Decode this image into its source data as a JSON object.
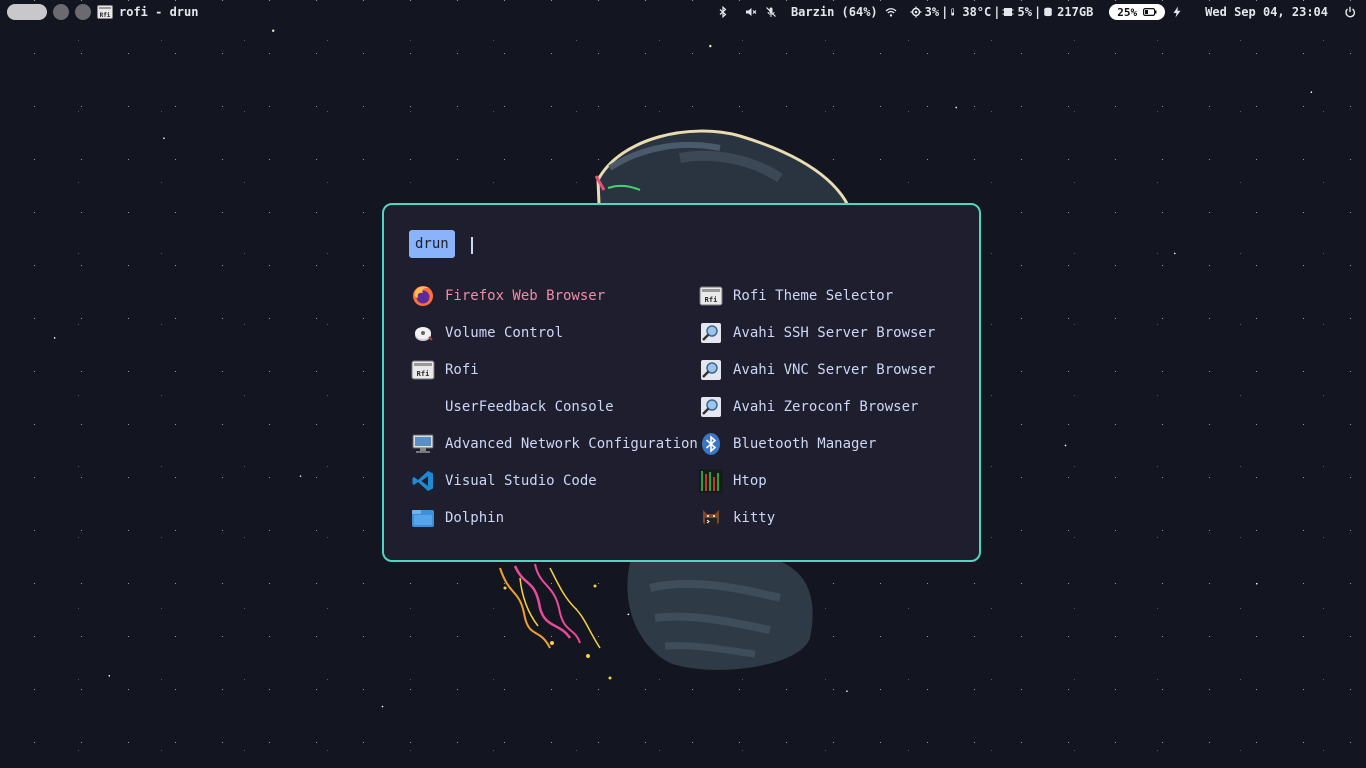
{
  "topbar": {
    "window_title": "rofi - drun",
    "wifi_label": "Barzin (64%)",
    "cpu": "3%",
    "temperature": "38°C",
    "memory": "5%",
    "disk": "217GB",
    "battery": "25%",
    "datetime": "Wed Sep 04, 23:04",
    "icons": [
      "bluetooth-icon",
      "volume-muted-icon",
      "mic-muted-icon",
      "wifi-icon",
      "cpu-icon",
      "thermometer-icon",
      "memory-icon",
      "disk-icon",
      "battery-icon",
      "charging-icon",
      "power-icon"
    ]
  },
  "rofi": {
    "mode": "drun",
    "query": "",
    "selected_index": 0,
    "entries": [
      {
        "label": "Firefox Web Browser",
        "icon": "firefox-icon"
      },
      {
        "label": "Volume Control",
        "icon": "volume-control-icon"
      },
      {
        "label": "Rofi",
        "icon": "rofi-icon"
      },
      {
        "label": "UserFeedback Console",
        "icon": ""
      },
      {
        "label": "Advanced Network Configuration",
        "icon": "network-config-icon"
      },
      {
        "label": "Visual Studio Code",
        "icon": "vscode-icon"
      },
      {
        "label": "Dolphin",
        "icon": "dolphin-icon"
      },
      {
        "label": "Rofi Theme Selector",
        "icon": "rofi-icon"
      },
      {
        "label": "Avahi SSH Server Browser",
        "icon": "avahi-icon"
      },
      {
        "label": "Avahi VNC Server Browser",
        "icon": "avahi-icon"
      },
      {
        "label": "Avahi Zeroconf Browser",
        "icon": "avahi-icon"
      },
      {
        "label": "Bluetooth Manager",
        "icon": "bluetooth-manager-icon"
      },
      {
        "label": "Htop",
        "icon": "htop-icon"
      },
      {
        "label": "kitty",
        "icon": "kitty-icon"
      }
    ]
  },
  "colors": {
    "background": "#131620",
    "rofi_bg": "#1e1e2e",
    "rofi_border": "#4fd6be",
    "prompt_bg": "#89b4fa",
    "selected_text": "#f38ba8",
    "text": "#cdd6f4"
  }
}
